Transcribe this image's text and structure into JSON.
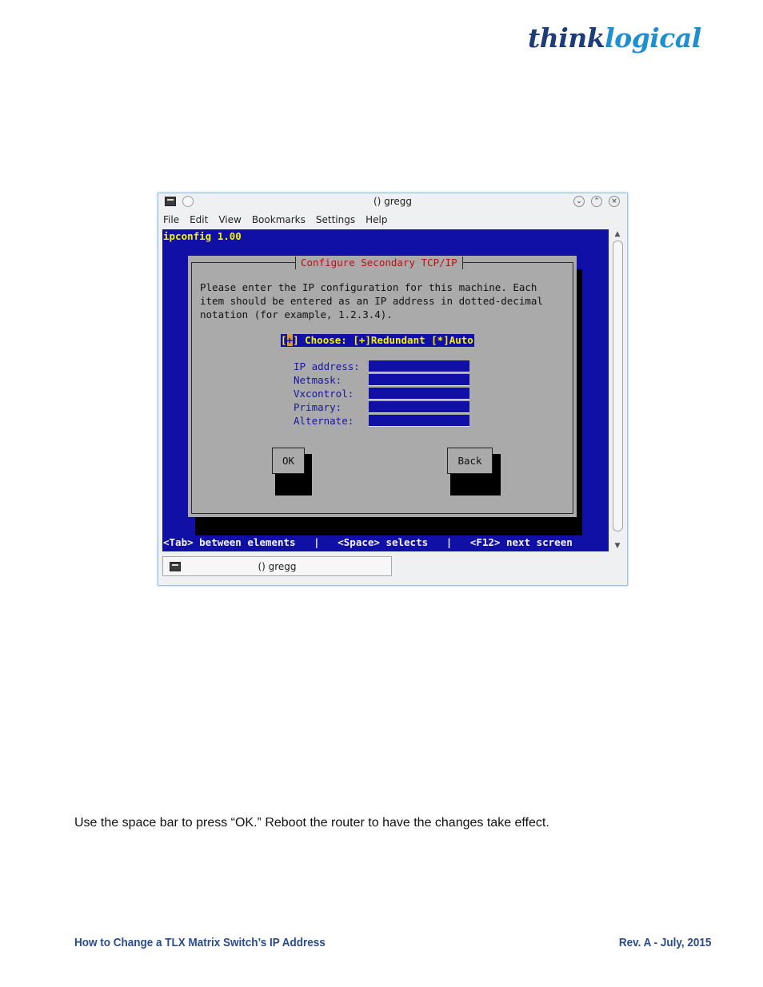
{
  "logo": {
    "part1": "think",
    "part2": "logical"
  },
  "window": {
    "title": "() gregg",
    "menu": [
      "File",
      "Edit",
      "View",
      "Bookmarks",
      "Settings",
      "Help"
    ],
    "controls": {
      "minimize": "⌄",
      "maximize": "⌃",
      "close": "×"
    },
    "tab_label": "() gregg"
  },
  "terminal": {
    "program": "ipconfig 1.00",
    "dialog_title": "Configure Secondary TCP/IP",
    "message": "Please enter the IP configuration for this machine. Each\nitem should be entered as an IP address in dotted-decimal\nnotation (for example, 1.2.3.4).",
    "choose": {
      "open": "[",
      "cursor": "+",
      "rest": "] Choose: [+]Redundant [*]Auto"
    },
    "fields": [
      {
        "label": "IP address:",
        "value": ""
      },
      {
        "label": "Netmask:",
        "value": ""
      },
      {
        "label": "Vxcontrol:",
        "value": ""
      },
      {
        "label": "Primary:",
        "value": ""
      },
      {
        "label": "Alternate:",
        "value": ""
      }
    ],
    "buttons": {
      "ok": "OK",
      "back": "Back"
    },
    "status": "<Tab> between elements   |   <Space> selects   |   <F12> next screen"
  },
  "body_text": "Use the space bar to press “OK.” Reboot the router to have the changes take effect.",
  "footer": {
    "left": "How to Change a TLX Matrix Switch’s IP Address",
    "right": "Rev. A - July, 2015"
  }
}
